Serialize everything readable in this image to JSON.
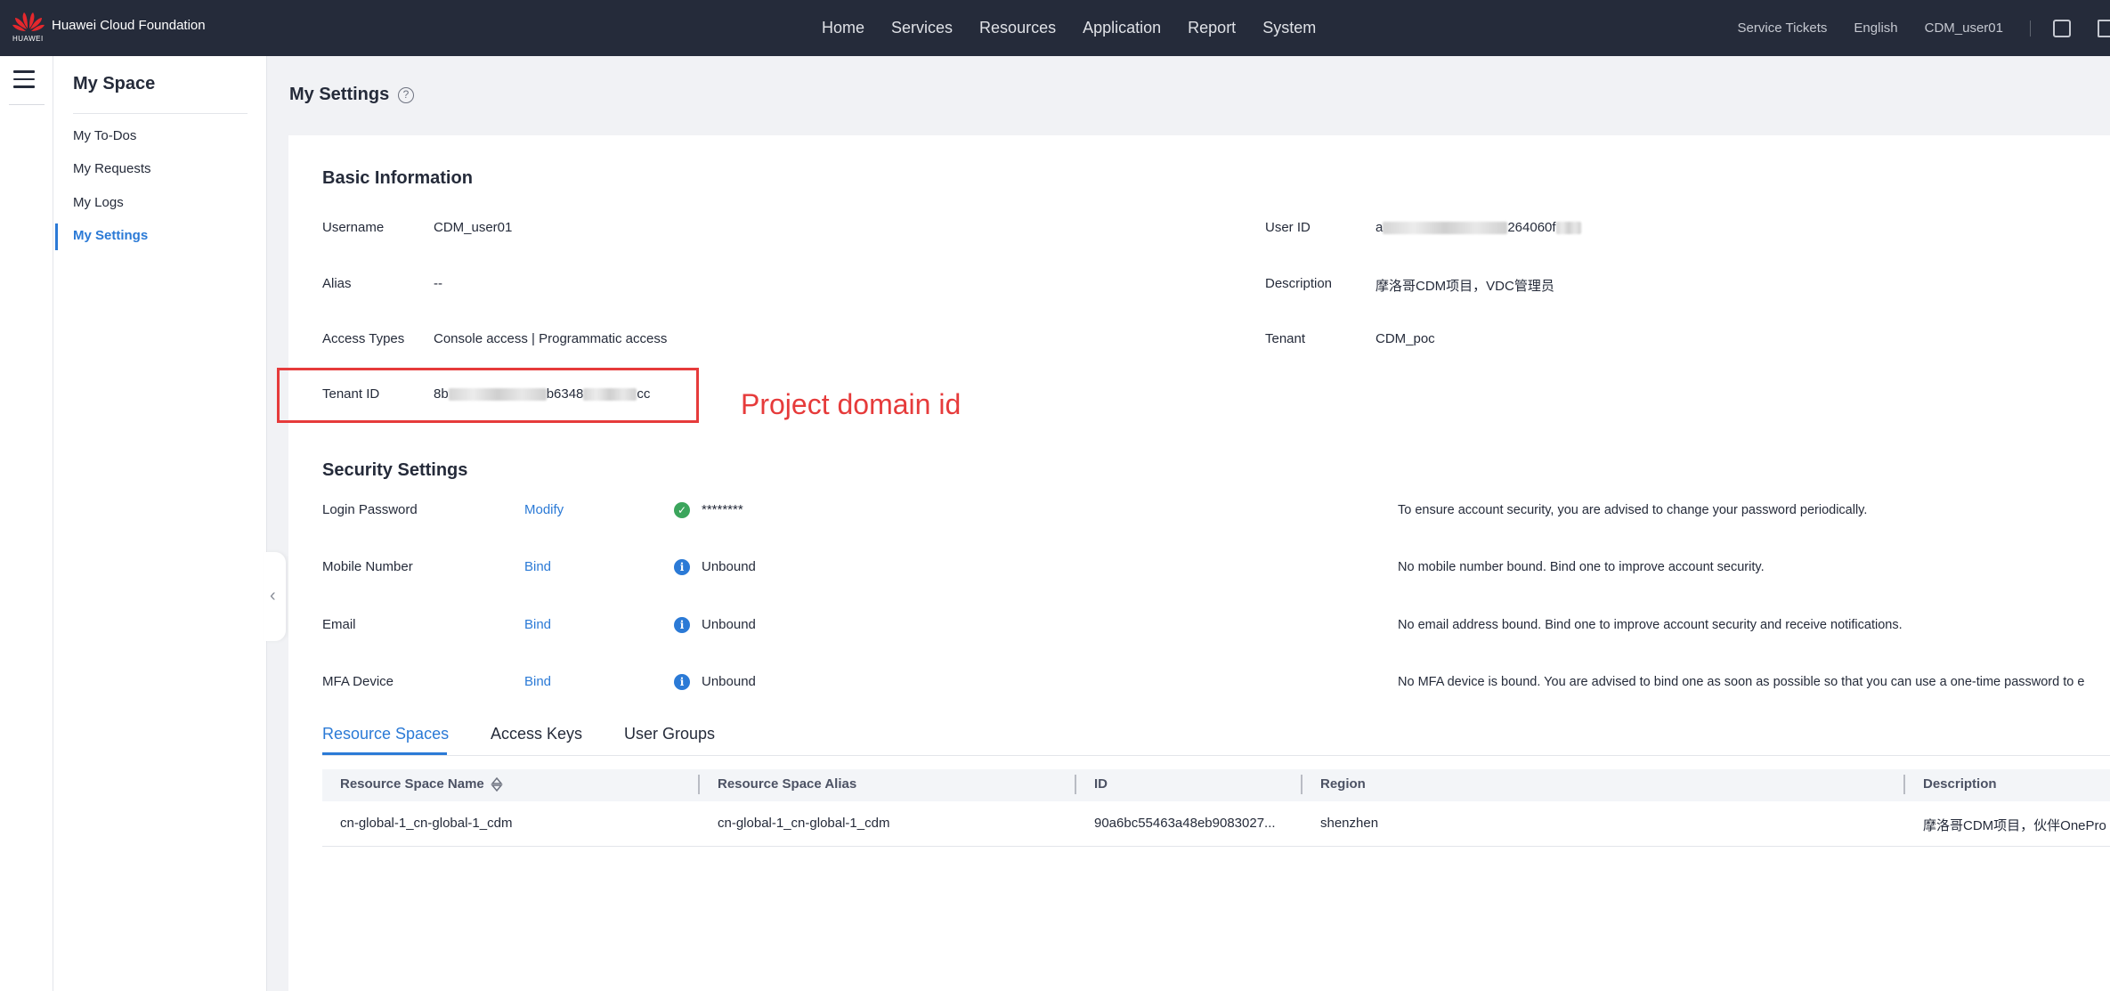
{
  "topbar": {
    "brand": "Huawei Cloud Foundation",
    "brand_sub": "HUAWEI",
    "nav": [
      "Home",
      "Services",
      "Resources",
      "Application",
      "Report",
      "System"
    ],
    "service_tickets": "Service Tickets",
    "language": "English",
    "user": "CDM_user01"
  },
  "sidebar": {
    "title": "My Space",
    "items": [
      {
        "label": "My To-Dos"
      },
      {
        "label": "My Requests"
      },
      {
        "label": "My Logs"
      },
      {
        "label": "My Settings",
        "active": true
      }
    ]
  },
  "page": {
    "title": "My Settings",
    "help": "?"
  },
  "basic": {
    "title": "Basic Information",
    "username_label": "Username",
    "username": "CDM_user01",
    "alias_label": "Alias",
    "alias": "--",
    "access_label": "Access Types",
    "access": "Console access | Programmatic access",
    "tenant_id_label": "Tenant ID",
    "tenant_id_a": "8b",
    "tenant_id_b": "b6348",
    "tenant_id_c": "cc",
    "user_id_label": "User ID",
    "user_id_a": "a",
    "user_id_b": "264060f",
    "description_label": "Description",
    "description": "摩洛哥CDM项目，VDC管理员",
    "tenant_label": "Tenant",
    "tenant": "CDM_poc"
  },
  "annotation": "Project domain id",
  "security": {
    "title": "Security Settings",
    "rows": [
      {
        "label": "Login Password",
        "action": "Modify",
        "status": "********",
        "hint": "To ensure account security, you are advised to change your password periodically."
      },
      {
        "label": "Mobile Number",
        "action": "Bind",
        "status": "Unbound",
        "hint": "No mobile number bound. Bind one to improve account security."
      },
      {
        "label": "Email",
        "action": "Bind",
        "status": "Unbound",
        "hint": "No email address bound. Bind one to improve account security and receive notifications."
      },
      {
        "label": "MFA Device",
        "action": "Bind",
        "status": "Unbound",
        "hint": "No MFA device is bound. You are advised to bind one as soon as possible so that you can use a one-time password to e"
      }
    ]
  },
  "tabs": [
    "Resource Spaces",
    "Access Keys",
    "User Groups"
  ],
  "table": {
    "columns": [
      "Resource Space Name",
      "Resource Space Alias",
      "ID",
      "Region",
      "Description"
    ],
    "rows": [
      [
        "cn-global-1_cn-global-1_cdm",
        "cn-global-1_cn-global-1_cdm",
        "90a6bc55463a48eb9083027...",
        "shenzhen",
        "摩洛哥CDM项目，伙伴OnePro"
      ]
    ]
  },
  "colors": {
    "accent": "#2b7ad6",
    "annotation": "#e63b3b",
    "topbar": "#252b3a",
    "ok": "#3ba55c"
  }
}
